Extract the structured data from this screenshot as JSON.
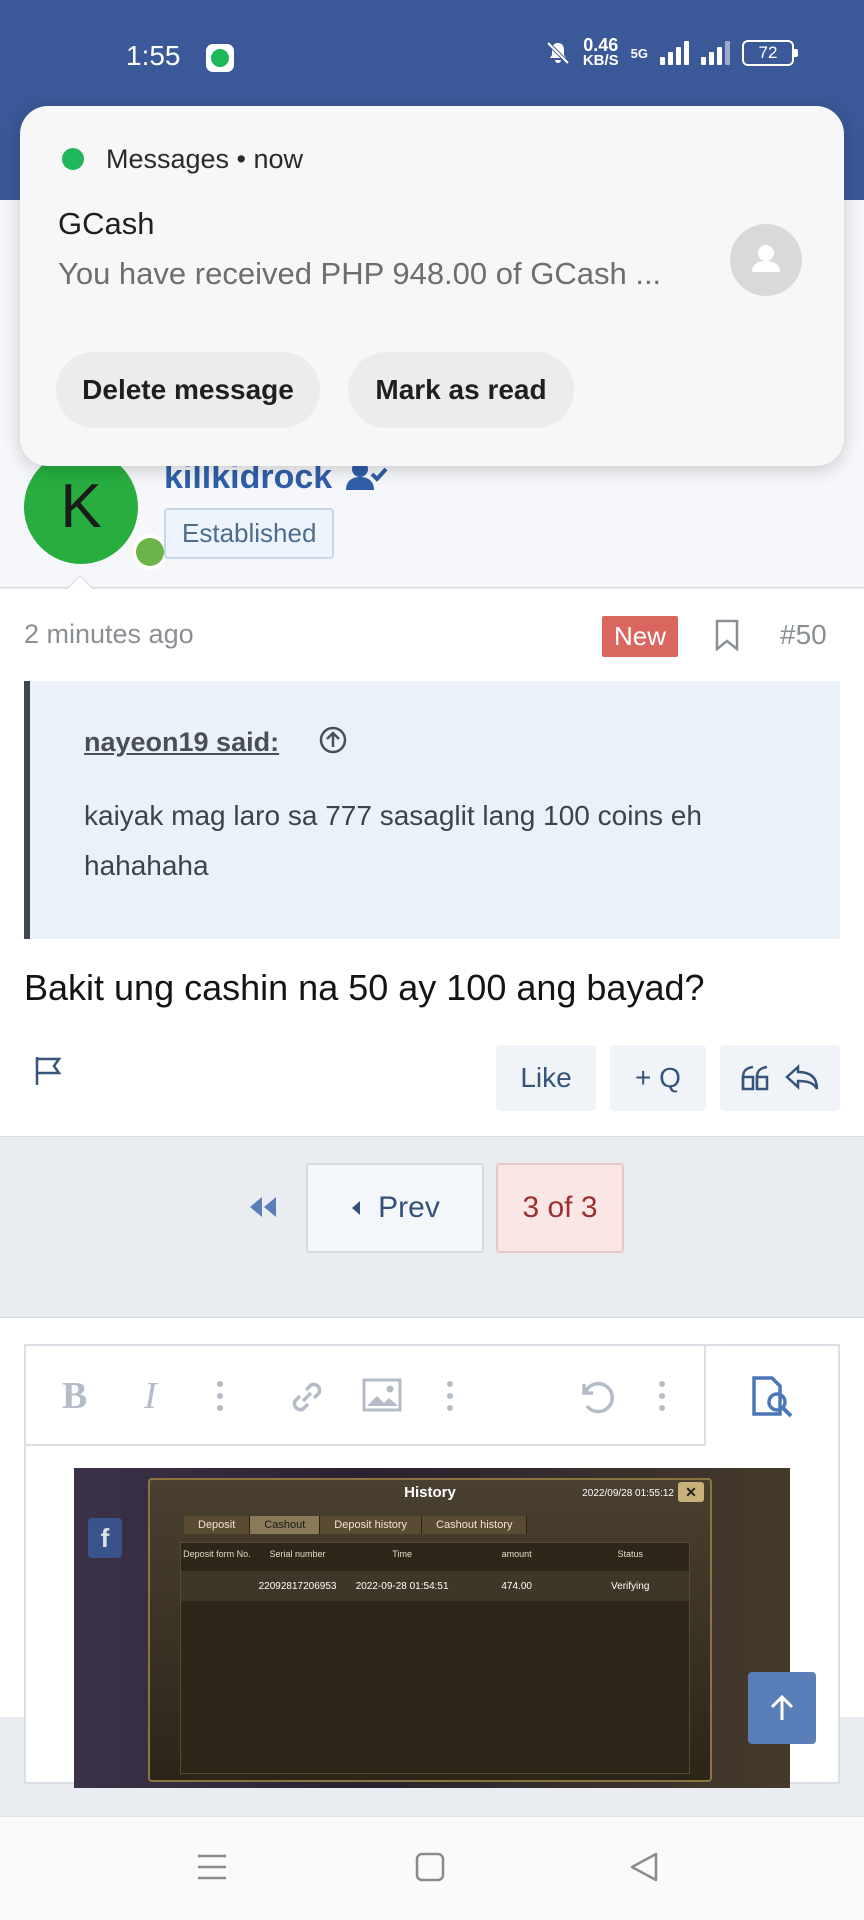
{
  "status_bar": {
    "time": "1:55",
    "net_speed": "0.46",
    "net_unit": "KB/S",
    "net_type": "5G",
    "battery": "72"
  },
  "notification": {
    "app": "Messages • now",
    "title": "GCash",
    "text": "You have received PHP 948.00 of GCash ...",
    "actions": [
      "Delete message",
      "Mark as read"
    ]
  },
  "author": {
    "initial": "K",
    "username": "killkidrock",
    "user_title": "Established"
  },
  "post": {
    "time": "2 minutes ago",
    "badge": "New",
    "number": "#50",
    "quote_author": "nayeon19 said:",
    "quote_text": "kaiyak mag laro sa 777 sasaglit lang 100 coins eh hahahaha",
    "body": "Bakit ung cashin na 50 ay 100 ang bayad?",
    "actions": {
      "like": "Like",
      "multiquote": "+ Q"
    }
  },
  "pagination": {
    "prev_label": "Prev",
    "current": "3 of 3"
  },
  "editor": {
    "bold": "B",
    "italic": "I"
  },
  "embedded_image": {
    "title": "History",
    "datetime": "2022/09/28 01:55:12",
    "close": "✕",
    "fb_label": "f",
    "tabs": [
      "Deposit",
      "Cashout",
      "Deposit history",
      "Cashout history"
    ],
    "active_tab": "Cashout",
    "columns": [
      "Deposit form No.",
      "Serial number",
      "Time",
      "amount",
      "Status"
    ],
    "rows": [
      {
        "form_no": "",
        "serial": "22092817206953",
        "time": "2022-09-28 01:54:51",
        "amount": "474.00",
        "status": "Verifying"
      }
    ]
  },
  "colors": {
    "header": "#3b5998",
    "avatar": "#27ae3f",
    "new_badge": "#d9675f",
    "link": "#2f5ea8"
  }
}
